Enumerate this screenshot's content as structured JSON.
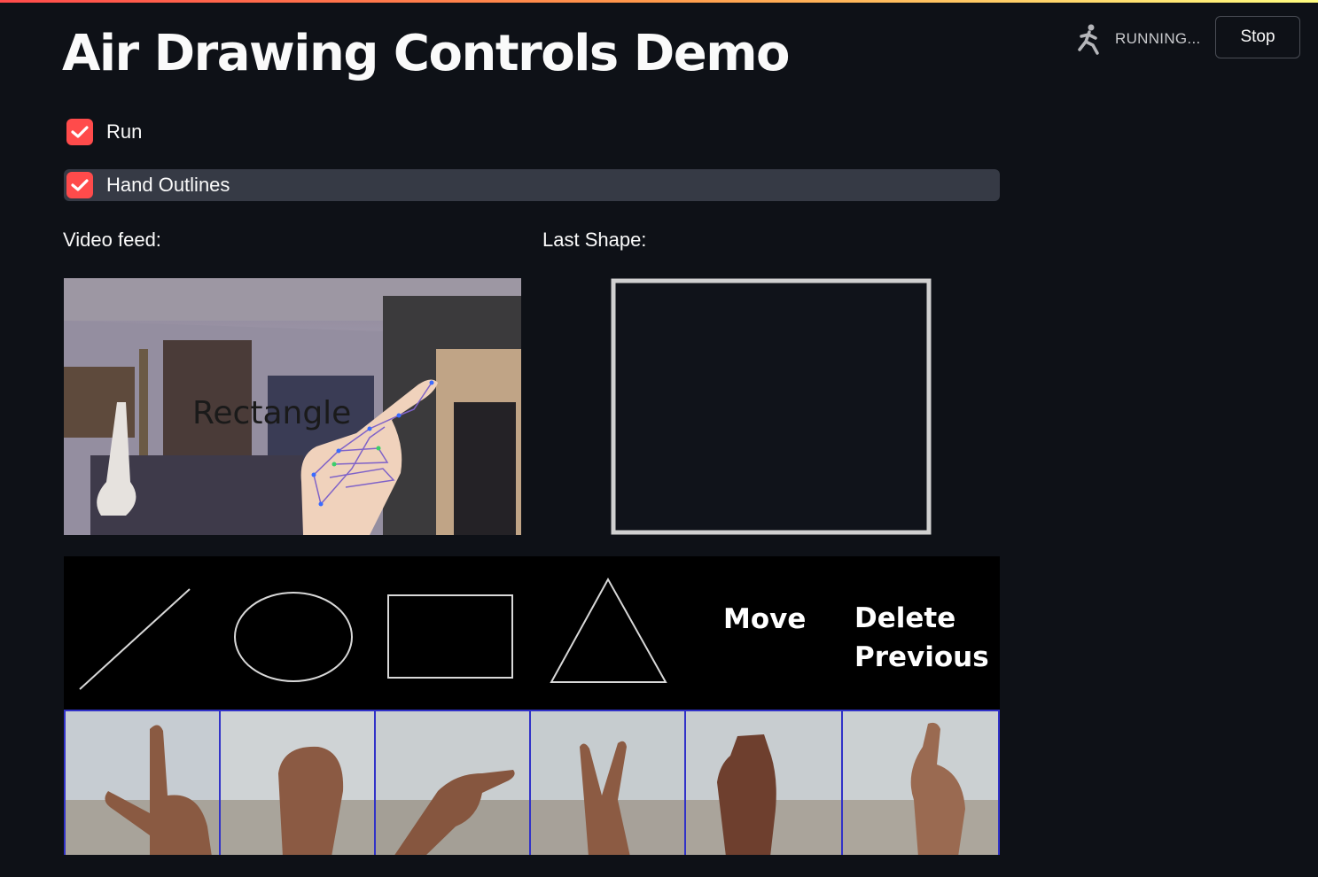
{
  "app": {
    "title": "Air Drawing Controls Demo",
    "status": {
      "text": "RUNNING...",
      "icon": "running-man-icon"
    },
    "stop_label": "Stop",
    "accent": "#ff4b4b"
  },
  "checkboxes": [
    {
      "label": "Run",
      "checked": true
    },
    {
      "label": "Hand Outlines",
      "checked": true
    }
  ],
  "video": {
    "heading": "Video feed:",
    "overlay_text": "Rectangle"
  },
  "last_shape": {
    "heading": "Last Shape:",
    "shape": "rectangle"
  },
  "controls": {
    "items": [
      {
        "shape": "line"
      },
      {
        "shape": "ellipse"
      },
      {
        "shape": "rectangle"
      },
      {
        "shape": "triangle"
      },
      {
        "text": "Move"
      },
      {
        "text_lines": [
          "Delete",
          "Previous"
        ]
      }
    ],
    "gestures": [
      "l-shape-hand",
      "fist",
      "pointing",
      "peace-sign",
      "flat-hand",
      "crossed-fingers"
    ]
  }
}
